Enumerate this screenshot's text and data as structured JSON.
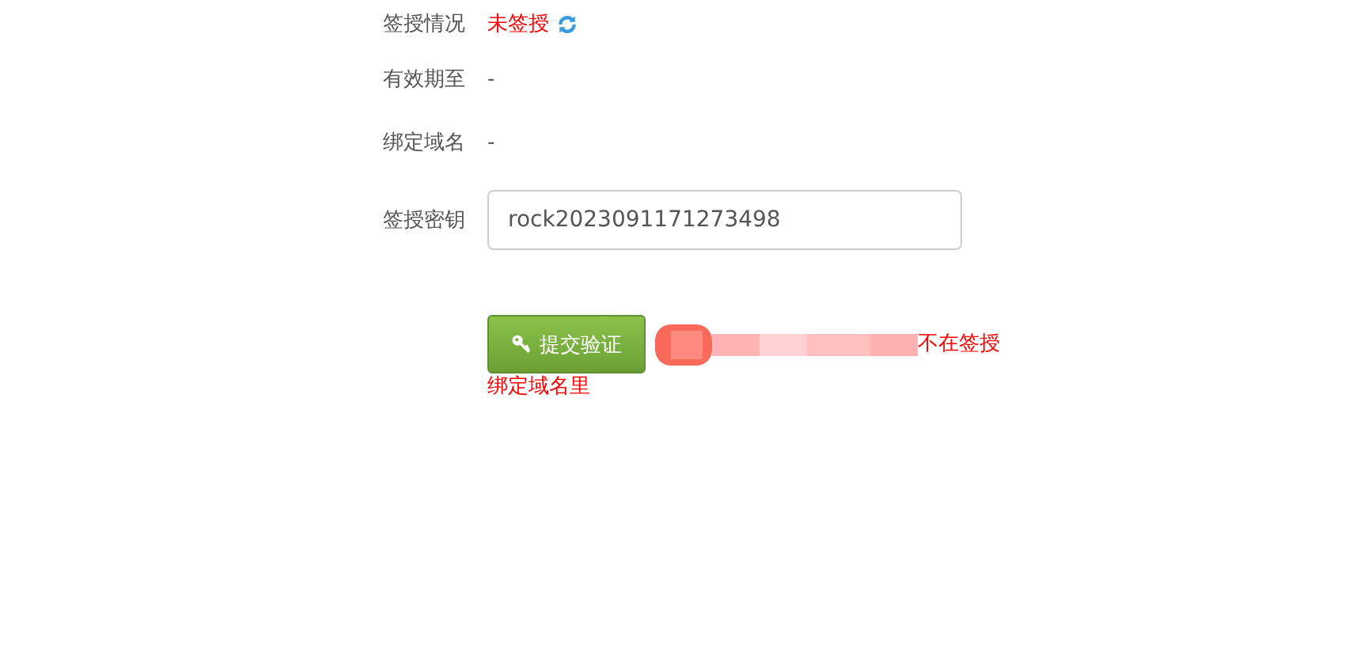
{
  "fields": [
    {
      "kind": "status",
      "label": "签授情况",
      "value": "未签授"
    },
    {
      "kind": "text",
      "label": "有效期至",
      "value": "-"
    },
    {
      "kind": "text",
      "label": "绑定域名",
      "value": "-"
    },
    {
      "kind": "input",
      "label": "签授密钥",
      "value": "rock2023091171273498"
    }
  ],
  "submit": {
    "label": "提交验证"
  },
  "error": {
    "lines": [
      "不在签授",
      "绑定域名里"
    ]
  }
}
